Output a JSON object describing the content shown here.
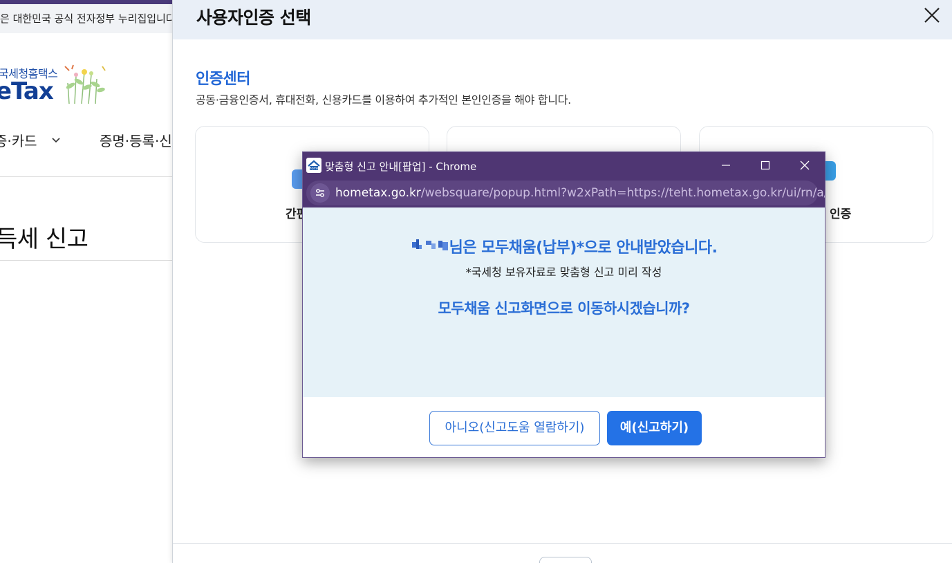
{
  "background_page": {
    "notice_text": "은 대한민국 공식 전자정부 누리집입니다",
    "logo_sub": "국세청홈택스",
    "logo_main": "eTax",
    "nav_items": [
      "증·카드",
      "증명·등록·신청"
    ],
    "page_heading": "득세 신고"
  },
  "modal": {
    "title": "사용자인증 선택",
    "section_title": "인증센터",
    "section_desc": "공동·금융인증서, 휴대전화, 신용카드를 이용하여 추가적인 본인인증을 해야 합니다.",
    "cards": [
      {
        "label": "간편"
      },
      {
        "label": ""
      },
      {
        "label": "인증"
      }
    ]
  },
  "popup": {
    "window_title": "맞춤형 신고 안내[팝업] - Chrome",
    "url_host": "hometax.go.kr",
    "url_path": "/websquare/popup.html?w2xPath=https://teht.hometax.go.kr/ui/rn/a/...",
    "message_line1": "님은 모두채움(납부)*으로 안내받았습니다.",
    "message_line2": "*국세청 보유자료로 맞춤형 신고 미리 작성",
    "message_line3": "모두채움 신고화면으로 이동하시겠습니까?",
    "button_no": "아니오(신고도움 열람하기)",
    "button_yes": "예(신고하기)"
  },
  "colors": {
    "accent_blue": "#2472e6",
    "popup_chrome_purple": "#4f3673",
    "popup_body_bg": "#e6f2f8",
    "modal_header_bg": "#e9eff7"
  }
}
